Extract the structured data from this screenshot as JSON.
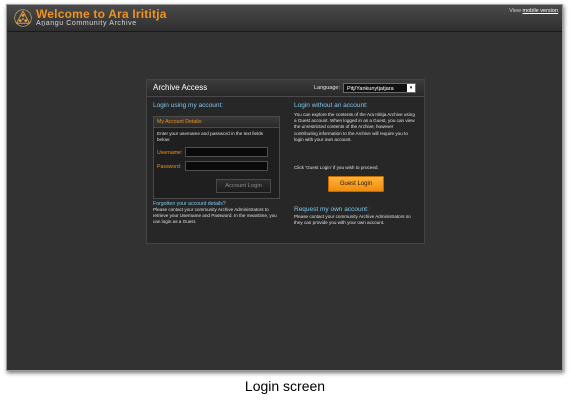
{
  "header": {
    "title": "Welcome to Ara Irititja",
    "subtitle": "Aṉangu Community Archive",
    "view_prefix": "View ",
    "view_link": "mobile version",
    "logo_icon": "archive-logo-icon"
  },
  "panel": {
    "title": "Archive Access",
    "language_label": "Language:",
    "language_value": "Pitj/Yankunytjatjara"
  },
  "login_account": {
    "heading": "Login using my account:",
    "details_title": "My Account Details:",
    "instructions": "Enter your username and password in the text fields below:",
    "username_label": "Username:",
    "username_value": "",
    "password_label": "Password:",
    "password_value": "",
    "button_label": "Account Login",
    "forgot_link": "Forgotten your account details?",
    "forgot_text": "Please contact your community Archive Administrators to retrieve your Username and Password. In the meantime, you can login as a Guest."
  },
  "login_guest": {
    "heading": "Login without an account:",
    "text": "You can explore the contents of the Ara Irititja Archive using a Guest account. When logged in as a Guest, you can view the unrestricted contents of the Archive; however contributing information to the Archive will require you to login with your own account.",
    "hint": "Click 'Guest Login' if you wish to proceed.",
    "button_label": "Guest Login"
  },
  "request_account": {
    "heading": "Request my own account:",
    "text": "Please contact your community Archive Administrators so they can provide you with your own account."
  },
  "caption": "Login screen",
  "colors": {
    "accent_orange": "#f0921c",
    "heading_blue": "#7ec8ee",
    "background": "#2d2d2d"
  }
}
